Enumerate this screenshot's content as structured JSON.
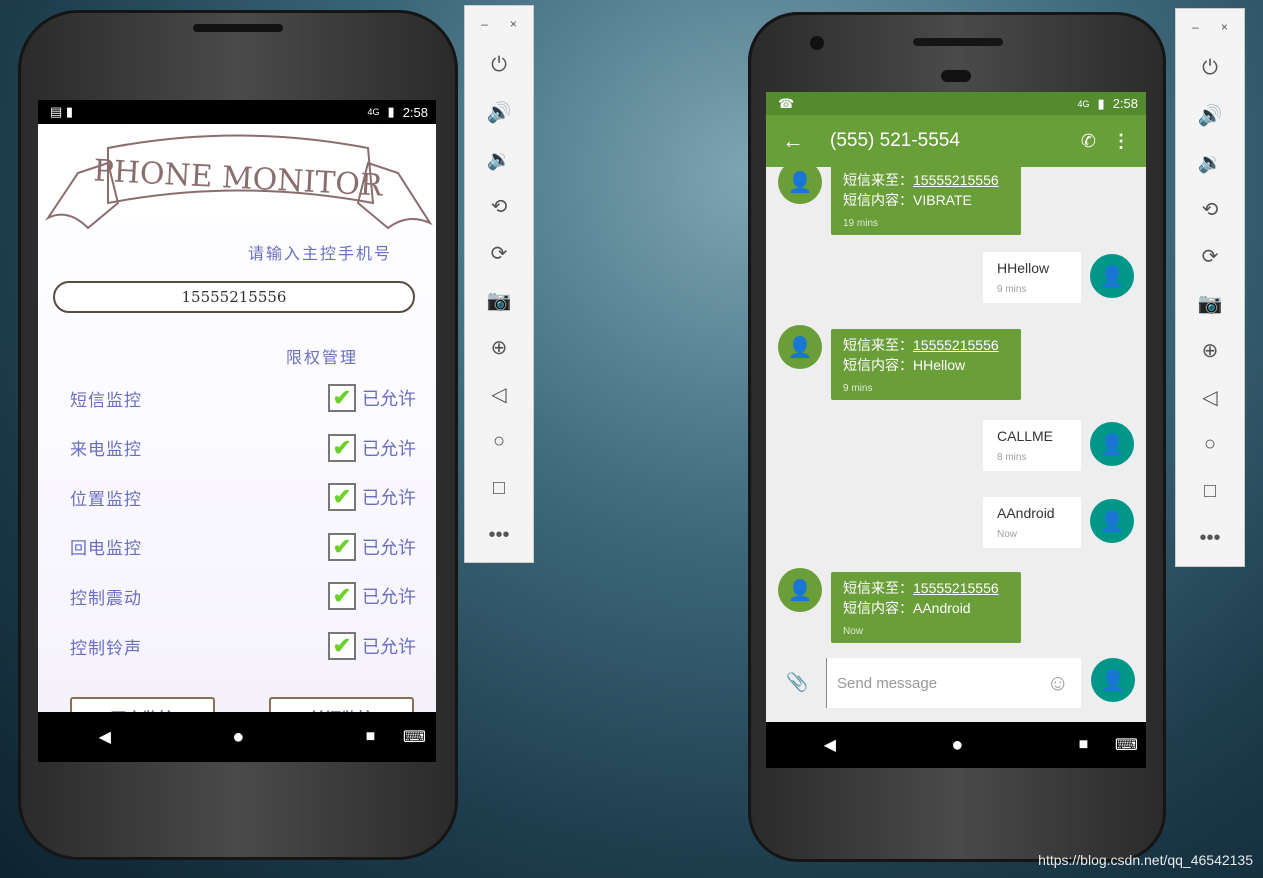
{
  "left_phone": {
    "status_time": "2:58",
    "status_network": "4G",
    "logo_text": "PHONE MONITOR",
    "prompt": "请输入主控手机号",
    "phone_input": "15555215556",
    "perm_title": "限权管理",
    "permissions": [
      {
        "label": "短信监控",
        "value": "已允许",
        "checked": true
      },
      {
        "label": "来电监控",
        "value": "已允许",
        "checked": true
      },
      {
        "label": "位置监控",
        "value": "已允许",
        "checked": true
      },
      {
        "label": "回电监控",
        "value": "已允许",
        "checked": true
      },
      {
        "label": "控制震动",
        "value": "已允许",
        "checked": true
      },
      {
        "label": "控制铃声",
        "value": "已允许",
        "checked": true
      }
    ],
    "start_button": "开启监控",
    "stop_button": "关闭监控"
  },
  "right_phone": {
    "status_time": "2:58",
    "status_network": "4G",
    "title": "(555) 521-5554",
    "accent": "#689f38",
    "outgoing_avatar": "#009688",
    "messages": [
      {
        "dir": "in",
        "line1_label": "短信来至：",
        "line1_link": "15555215556",
        "line2": "短信内容：VIBRATE",
        "time": "19 mins"
      },
      {
        "dir": "out",
        "text": "HHellow",
        "time": "9 mins"
      },
      {
        "dir": "in",
        "line1_label": "短信来至：",
        "line1_link": "15555215556",
        "line2": "短信内容：HHellow",
        "time": "9 mins"
      },
      {
        "dir": "out",
        "text": "CALLME",
        "time": "8 mins"
      },
      {
        "dir": "out",
        "text": "AAndroid",
        "time": "Now"
      },
      {
        "dir": "in",
        "line1_label": "短信来至：",
        "line1_link": "15555215556",
        "line2": "短信内容：AAndroid",
        "time": "Now"
      }
    ],
    "compose_placeholder": "Send message"
  },
  "toolbar": {
    "minimize": "–",
    "close": "×"
  },
  "watermark": "https://blog.csdn.net/qq_46542135"
}
